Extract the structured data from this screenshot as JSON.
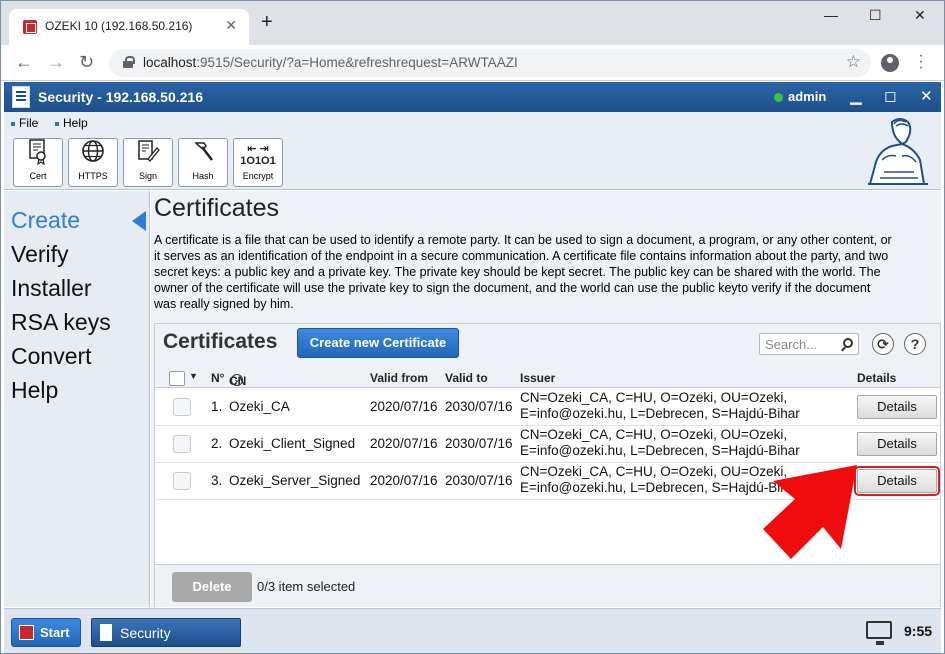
{
  "browser": {
    "tab_title": "OZEKI 10 (192.168.50.216)",
    "tab_close": "✕",
    "new_tab": "+",
    "url_host": "localhost",
    "url_rest": ":9515/Security/?a=Home&refreshrequest=ARWTAAZI"
  },
  "app": {
    "title": "Security - 192.168.50.216",
    "user": "admin"
  },
  "menu": {
    "file": "File",
    "help": "Help"
  },
  "toolbar": [
    {
      "label": "Cert",
      "icon": "certificate-icon"
    },
    {
      "label": "HTTPS",
      "icon": "globe-icon"
    },
    {
      "label": "Sign",
      "icon": "sign-icon"
    },
    {
      "label": "Hash",
      "icon": "hammer-icon"
    },
    {
      "label": "Encrypt",
      "icon": "encrypt-icon"
    }
  ],
  "sidebar": {
    "items": [
      {
        "label": "Create",
        "active": true
      },
      {
        "label": "Verify"
      },
      {
        "label": "Installer"
      },
      {
        "label": "RSA keys"
      },
      {
        "label": "Convert"
      },
      {
        "label": "Help"
      }
    ]
  },
  "main": {
    "title": "Certificates",
    "description": "A certificate is a file that can be used to identify a remote party. It can be used to sign a document, a program, or any other content, or it serves as an identification of the endpoint in a secure communication. A certificate file contains information about the party, and two secret keys: a public key and a private key. The private key should be kept secret. The public key can be shared with the world. The owner of the certificate will use the private key to sign the document, and the world can use the public keyto verify if the document was really signed by him."
  },
  "panel": {
    "title": "Certificates",
    "create_button": "Create new Certificate",
    "search_placeholder": "Search...",
    "help_label": "?",
    "columns": {
      "no": "N°",
      "cn": "CN",
      "valid_from": "Valid from",
      "valid_to": "Valid to",
      "issuer": "Issuer",
      "details": "Details"
    },
    "rows": [
      {
        "no": "1.",
        "cn": "Ozeki_CA",
        "valid_from": "2020/07/16",
        "valid_to": "2030/07/16",
        "issuer_line1": "CN=Ozeki_CA, C=HU, O=Ozeki, OU=Ozeki,",
        "issuer_line2": "E=info@ozeki.hu, L=Debrecen, S=Hajdú-Bihar",
        "details": "Details"
      },
      {
        "no": "2.",
        "cn": "Ozeki_Client_Signed",
        "valid_from": "2020/07/16",
        "valid_to": "2030/07/16",
        "issuer_line1": "CN=Ozeki_CA, C=HU, O=Ozeki, OU=Ozeki,",
        "issuer_line2": "E=info@ozeki.hu, L=Debrecen, S=Hajdú-Bihar",
        "details": "Details"
      },
      {
        "no": "3.",
        "cn": "Ozeki_Server_Signed",
        "valid_from": "2020/07/16",
        "valid_to": "2030/07/16",
        "issuer_line1": "CN=Ozeki_CA, C=HU, O=Ozeki, OU=Ozeki,",
        "issuer_line2": "E=info@ozeki.hu, L=Debrecen, S=Hajdú-Bihar",
        "details": "Details"
      }
    ],
    "delete_button": "Delete",
    "selection_info": "0/3 item selected"
  },
  "taskbar": {
    "start": "Start",
    "task_security": "Security",
    "clock": "9:55"
  },
  "colors": {
    "accent": "#2466b8",
    "title_bar": "#1d4f8c",
    "highlight": "#d21f1f",
    "status_online": "#3fbf3f"
  }
}
